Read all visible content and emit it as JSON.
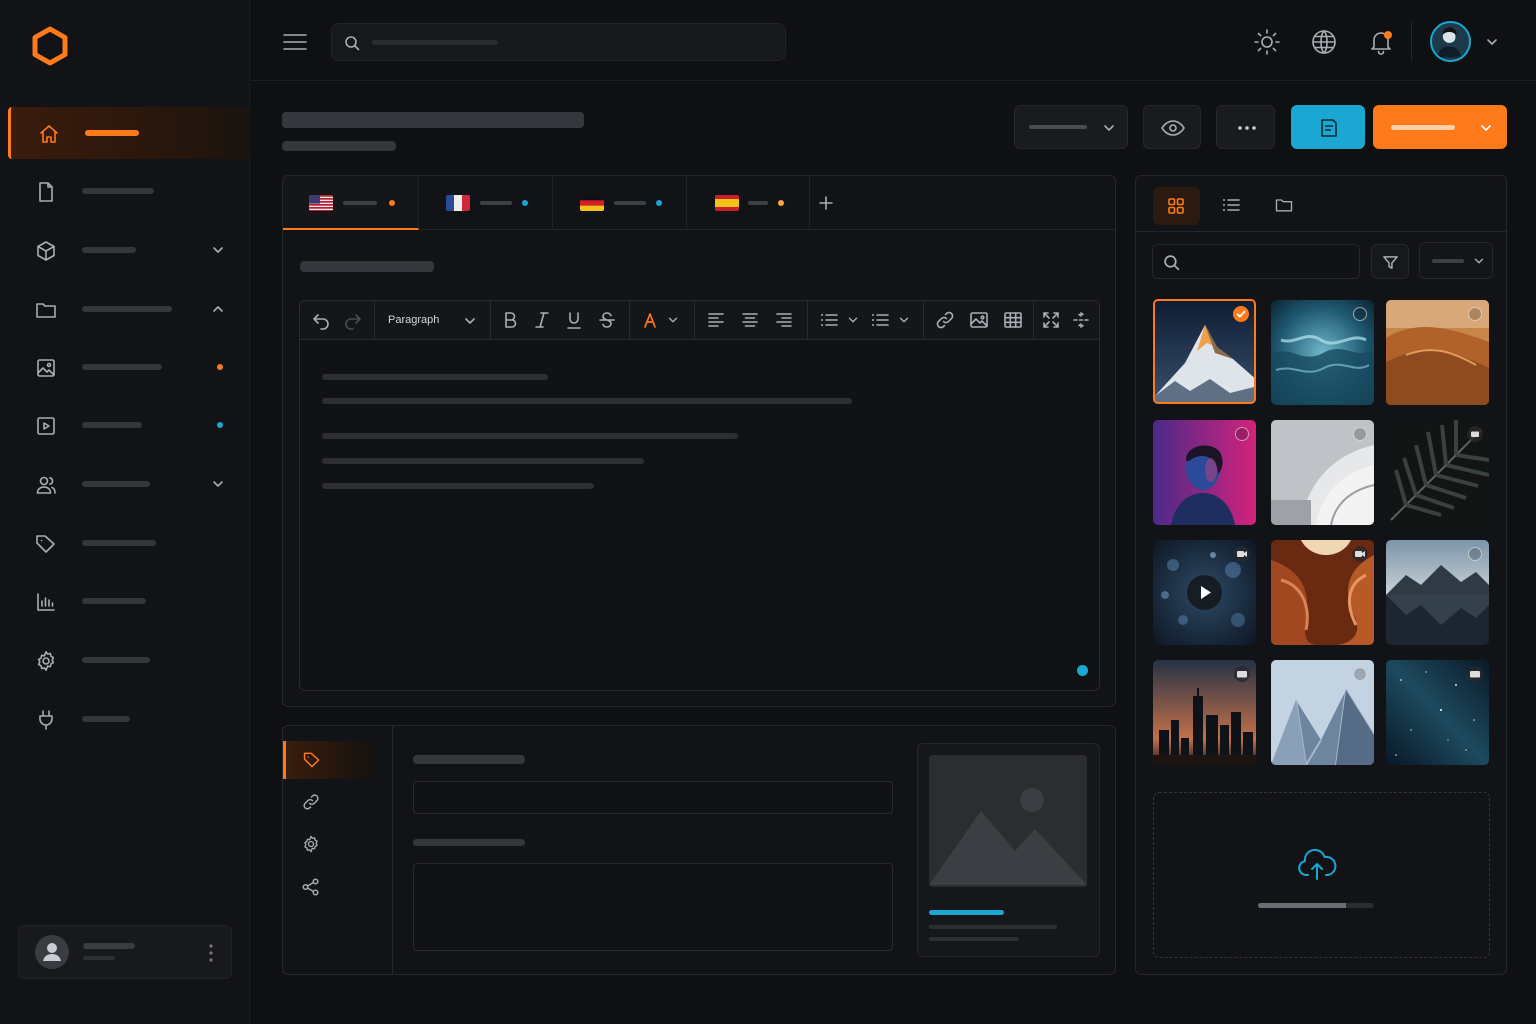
{
  "editor": {
    "block_format": "Paragraph"
  },
  "icons": {
    "logo": "hexagon-logo",
    "menu": "hamburger-icon",
    "search": "search-icon",
    "theme": "sun-icon",
    "language": "globe-icon",
    "notifications": "bell-icon",
    "preview": "eye-icon",
    "more": "ellipsis-icon",
    "save": "save-icon",
    "upload": "cloud-upload-icon"
  },
  "colors": {
    "accent": "#ff7a1a",
    "info": "#1aa7d1",
    "background": "#0f1012"
  },
  "media": {
    "views": [
      "grid",
      "list",
      "folder"
    ],
    "active_view": "grid"
  }
}
